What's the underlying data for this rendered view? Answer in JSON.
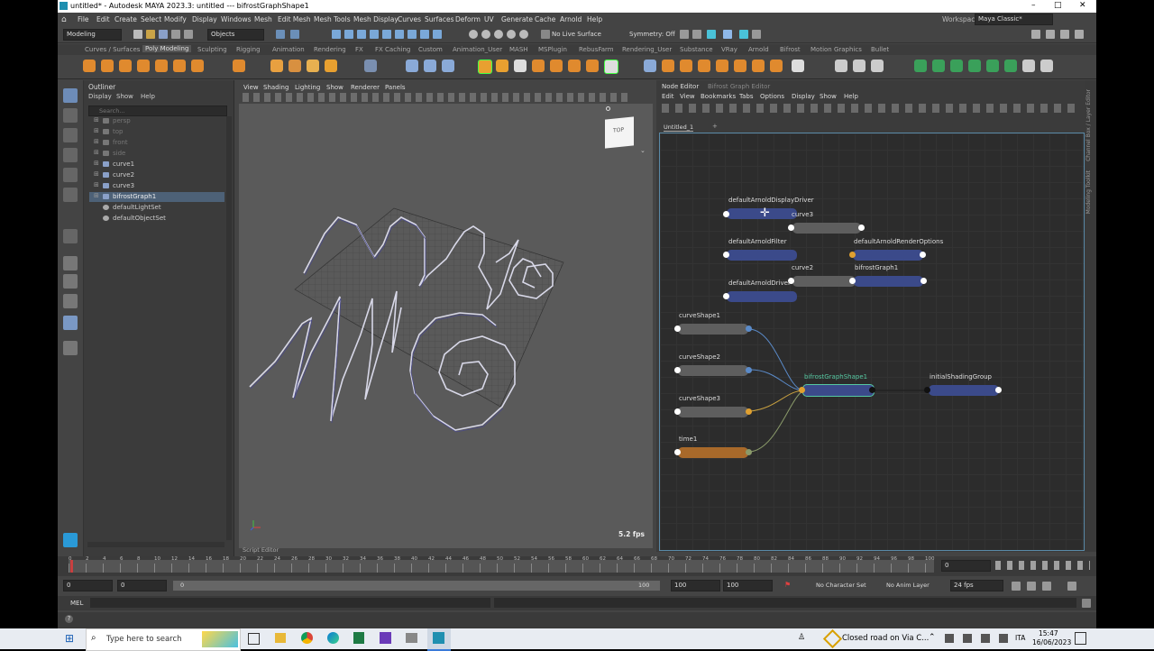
{
  "window": {
    "title": "untitled* - Autodesk MAYA 2023.3: untitled   ---   bifrostGraphShape1",
    "controls": [
      "–",
      "□",
      "✕"
    ]
  },
  "menubar": {
    "items": [
      "File",
      "Edit",
      "Create",
      "Select",
      "Modify",
      "Display",
      "Windows",
      "Mesh",
      "Edit Mesh",
      "Mesh Tools",
      "Mesh Display",
      "Curves",
      "Surfaces",
      "Deform",
      "UV",
      "Generate",
      "Cache",
      "Arnold",
      "Help"
    ],
    "workspace_label": "Workspace:",
    "workspace_value": "Maya Classic*"
  },
  "statusline": {
    "mode": "Modeling",
    "objects": "Objects",
    "live_surface": "No Live Surface",
    "symmetry": "Symmetry: Off"
  },
  "shelf_tabs": [
    "Curves / Surfaces",
    "Poly Modeling",
    "Sculpting",
    "Rigging",
    "Animation",
    "Rendering",
    "FX",
    "FX Caching",
    "Custom",
    "Animation_User",
    "MASH",
    "MSPlugin",
    "RebusFarm",
    "Rendering_User",
    "Substance",
    "VRay",
    "Arnold",
    "Bifrost",
    "Motion Graphics",
    "Bullet"
  ],
  "shelf_active": "Poly Modeling",
  "outliner": {
    "title": "Outliner",
    "menu": [
      "Display",
      "Show",
      "Help"
    ],
    "search_placeholder": "Search...",
    "items": [
      {
        "label": "persp",
        "dim": true
      },
      {
        "label": "top",
        "dim": true
      },
      {
        "label": "front",
        "dim": true
      },
      {
        "label": "side",
        "dim": true
      },
      {
        "label": "curve1",
        "dim": false
      },
      {
        "label": "curve2",
        "dim": false
      },
      {
        "label": "curve3",
        "dim": false
      },
      {
        "label": "bifrostGraph1",
        "dim": false,
        "selected": true
      },
      {
        "label": "defaultLightSet",
        "dim": false
      },
      {
        "label": "defaultObjectSet",
        "dim": false
      }
    ]
  },
  "viewport": {
    "menu": [
      "View",
      "Shading",
      "Lighting",
      "Show",
      "Renderer",
      "Panels"
    ],
    "viewcube_label": "TOP",
    "fps": "5.2 fps"
  },
  "script_editor_label": "Script Editor",
  "node_editor": {
    "tabs": [
      "Node Editor",
      "Bifrost Graph Editor"
    ],
    "menu": [
      "Edit",
      "View",
      "Bookmarks",
      "Tabs",
      "Options",
      "Display",
      "Show",
      "Help"
    ],
    "graph_tab": "Untitled_1",
    "add_tab": "+",
    "nodes": {
      "n1": "defaultArnoldDisplayDriver",
      "n2": "curve3",
      "n3": "defaultArnoldFilter",
      "n4": "defaultArnoldRenderOptions",
      "n5": "curve2",
      "n6": "bifrostGraph1",
      "n7": "defaultArnoldDriver",
      "n8": "curveShape1",
      "n9": "curveShape2",
      "n10": "curveShape3",
      "n11": "bifrostGraphShape1",
      "n12": "initialShadingGroup",
      "n13": "time1"
    }
  },
  "right_strip": [
    "Channel Box / Layer Editor",
    "Modeling Toolkit"
  ],
  "timeline": {
    "ticks": [
      "0",
      "2",
      "4",
      "6",
      "8",
      "10",
      "12",
      "14",
      "16",
      "18",
      "20",
      "22",
      "24",
      "26",
      "28",
      "30",
      "32",
      "34",
      "36",
      "38",
      "40",
      "42",
      "44",
      "46",
      "48",
      "50",
      "52",
      "54",
      "56",
      "58",
      "60",
      "62",
      "64",
      "66",
      "68",
      "70",
      "72",
      "74",
      "76",
      "78",
      "80",
      "82",
      "84",
      "86",
      "88",
      "90",
      "92",
      "94",
      "96",
      "98",
      "100"
    ],
    "current_frame": "0"
  },
  "range": {
    "start": "0",
    "playback_start": "0",
    "range_start": "0",
    "range_end": "100",
    "playback_end": "100",
    "end": "100",
    "character_set": "No Character Set",
    "anim_layer": "No Anim Layer",
    "fps": "24 fps"
  },
  "mel_label": "MEL",
  "taskbar": {
    "search_placeholder": "Type here to search",
    "notification": "Closed road on Via C...",
    "lang": "ITA",
    "time": "15:47",
    "date": "16/06/2023"
  },
  "colors": {
    "node_blue": "#3b4a8a",
    "node_gray": "#5e5e5e",
    "node_orange": "#a8692a",
    "bifrost_green": "#56c9a2",
    "graph_bg": "#2c2c2c"
  }
}
